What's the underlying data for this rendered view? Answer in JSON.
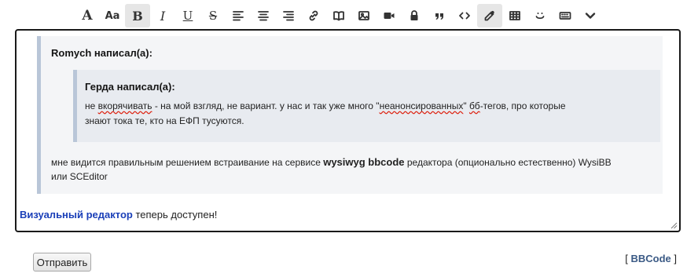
{
  "toolbar": {
    "font_label": "A",
    "size_label": "Aa",
    "bold_label": "B",
    "italic_label": "I",
    "underline_label": "U",
    "strike_label": "S",
    "quote_glyph": "””",
    "code_glyph": "<>"
  },
  "post": {
    "outer_author": "Romych написал(а):",
    "inner_author": "Герда написал(а):",
    "inner_text": {
      "w1": "не",
      "w2": "вкорячивать",
      "w3": "- на мой взгляд, не вариант. у нас и так уже много \"",
      "w4": "неанонсированных",
      "w5": "\"",
      "w6": "бб",
      "w7": "-тегов, про которые",
      "line2": "знают тока те, кто на ЕФП тусуются."
    },
    "outer_text": {
      "part1": "мне видится правильным решением встраивание на сервисе ",
      "bold": "wysiwyg bbcode",
      "part2": " редактора (опционально естественно) WysiBB",
      "line2": "или SCEditor"
    }
  },
  "editor_line": {
    "link": "Визуальный редактор",
    "rest": " теперь доступен!"
  },
  "submit_label": "Отправить",
  "bbcode": {
    "open": "[ ",
    "link": "BBCode",
    "close": " ]"
  },
  "colors": {
    "link_blue": "#1a3fb8",
    "bbcode_link": "#3b5a85",
    "quote_border": "#b9c6d8"
  }
}
